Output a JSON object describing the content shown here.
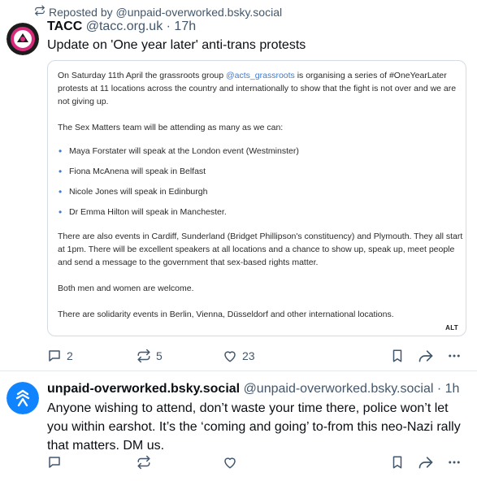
{
  "post1": {
    "repost_text": "Reposted by @unpaid-overworked.bsky.social",
    "author_name": "TACC",
    "author_meta": "@tacc.org.uk · 17h",
    "text": "Update on 'One year later' anti-trans protests",
    "image": {
      "p1_a": "On Saturday 11th April the grassroots group ",
      "p1_link": "@acts_grassroots",
      "p1_b": " is organising a series of #OneYearLater protests at 11 locations across the country and internationally to show that the fight is not over and we are not giving up.",
      "p2": "The Sex Matters team will be attending as many as we can:",
      "bullets": [
        "Maya Forstater will speak at the London event (Westminster)",
        "Fiona McAnena will speak in Belfast",
        "Nicole Jones will speak in Edinburgh",
        "Dr Emma Hilton will speak in Manchester."
      ],
      "p3": "There are also events in Cardiff, Sunderland (Bridget Phillipson's constituency) and Plymouth. They all start at 1pm. There will be excellent speakers at all locations and a chance to show up, speak up, meet people and send a message to the government that sex-based rights matter.",
      "p4": "Both men and women are welcome.",
      "p5": "There are solidarity events in Berlin, Vienna, Düsseldorf and other international locations.",
      "alt": "ALT"
    },
    "replies": "2",
    "reposts": "5",
    "likes": "23"
  },
  "post2": {
    "author_name": "unpaid-overworked.bsky.social",
    "author_meta": "@unpaid-overworked.bsky.social · 1h",
    "text": "Anyone wishing to attend, don’t waste your time there, police won’t let you within earshot.  It’s the ‘coming and going’ to-from this neo-Nazi rally that matters.  DM us."
  },
  "colors": {
    "muted": "#42576c",
    "link": "#3b7bd6",
    "divider": "#e3e8ed"
  },
  "icons": [
    "repost-icon",
    "reply-icon",
    "like-icon",
    "bookmark-icon",
    "share-icon",
    "more-icon"
  ]
}
